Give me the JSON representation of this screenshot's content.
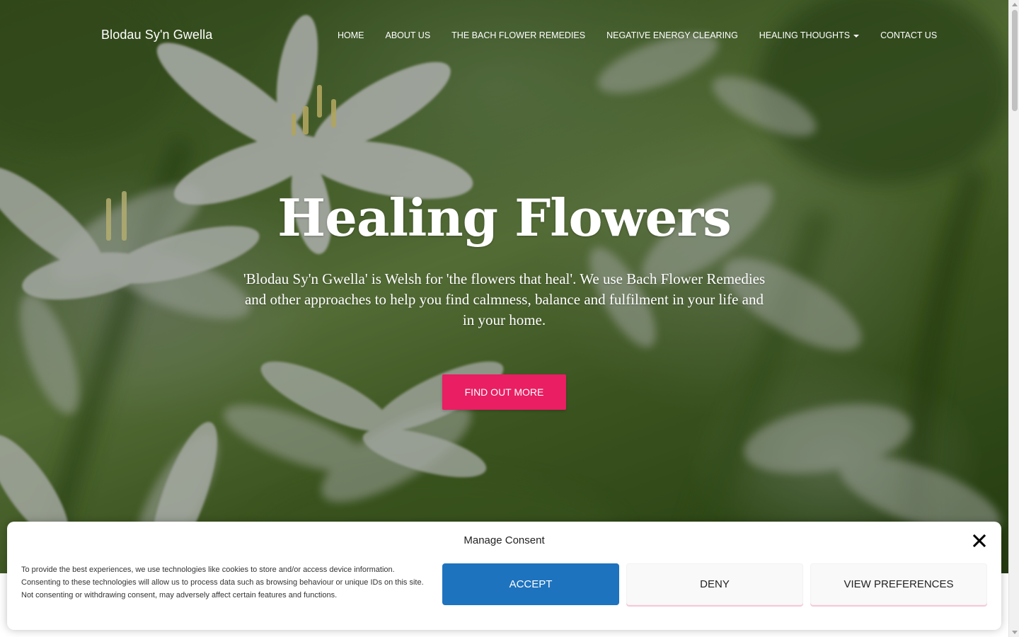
{
  "site": {
    "brand": "Blodau Sy'n Gwella"
  },
  "nav": {
    "items": [
      {
        "label": "HOME",
        "dropdown": false
      },
      {
        "label": "ABOUT US",
        "dropdown": false
      },
      {
        "label": "THE BACH FLOWER REMEDIES",
        "dropdown": false
      },
      {
        "label": "NEGATIVE ENERGY CLEARING",
        "dropdown": false
      },
      {
        "label": "HEALING THOUGHTS",
        "dropdown": true
      },
      {
        "label": "CONTACT US",
        "dropdown": false
      }
    ]
  },
  "hero": {
    "title": "Healing Flowers",
    "text": "'Blodau Sy'n Gwella' is Welsh for 'the flowers that heal'. We use Bach Flower Remedies and other approaches to help you find calmness, balance and fulfilment in your life and in your home.",
    "cta_label": "FIND OUT MORE",
    "background_image": "white star-of-bethlehem flowers on green blurred background"
  },
  "consent": {
    "title": "Manage Consent",
    "text": "To provide the best experiences, we use technologies like cookies to store and/or access device information. Consenting to these technologies will allow us to process data such as browsing behaviour or unique IDs on this site. Not consenting or withdrawing consent, may adversely affect certain features and functions.",
    "accept_label": "ACCEPT",
    "deny_label": "DENY",
    "preferences_label": "VIEW PREFERENCES"
  },
  "colors": {
    "accent": "#e91e63",
    "accept_blue": "#1e73be"
  },
  "icons": {
    "close": "close-icon",
    "dropdown": "caret-down-icon"
  }
}
